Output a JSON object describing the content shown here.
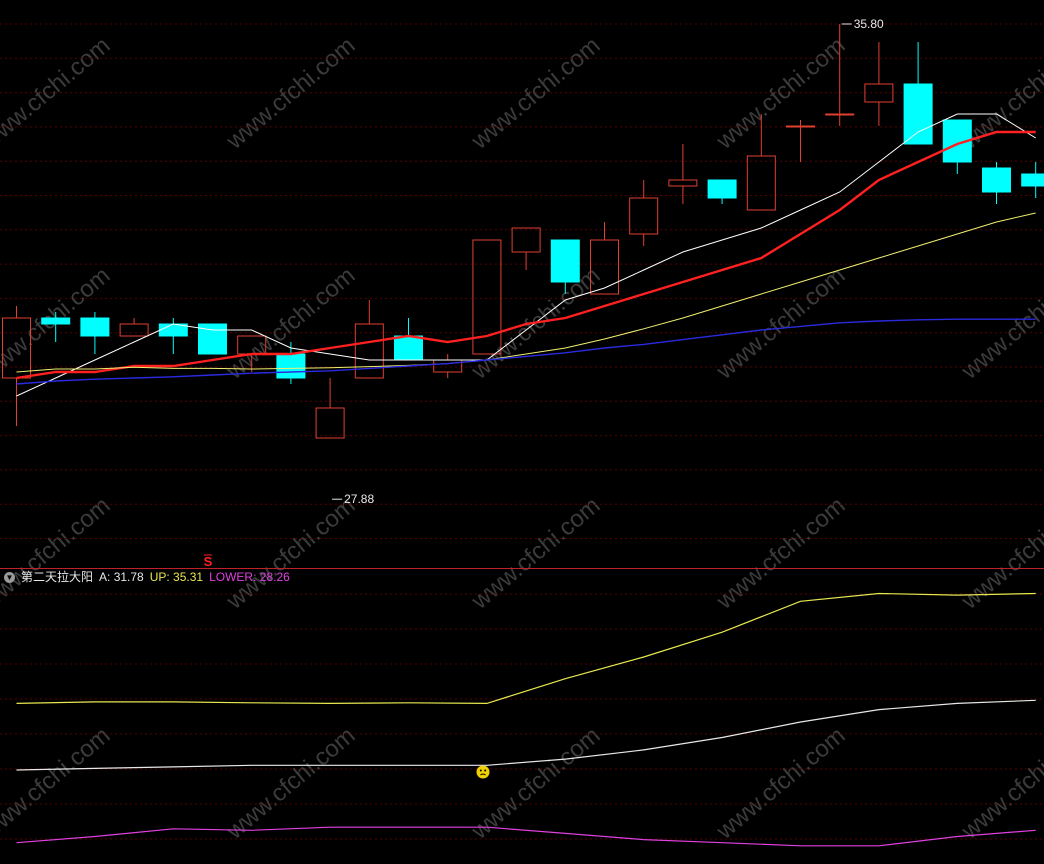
{
  "chart_data": [
    {
      "type": "candlestick",
      "price_range": [
        27.0,
        36.2
      ],
      "candles": [
        {
          "o": 29.9,
          "h": 31.1,
          "l": 29.1,
          "c": 30.9
        },
        {
          "o": 30.9,
          "h": 31.0,
          "l": 30.5,
          "c": 30.8
        },
        {
          "o": 30.9,
          "h": 31.0,
          "l": 30.3,
          "c": 30.6
        },
        {
          "o": 30.6,
          "h": 30.9,
          "l": 30.6,
          "c": 30.8
        },
        {
          "o": 30.8,
          "h": 30.9,
          "l": 30.3,
          "c": 30.6
        },
        {
          "o": 30.8,
          "h": 30.8,
          "l": 30.3,
          "c": 30.3
        },
        {
          "o": 30.3,
          "h": 30.6,
          "l": 30.0,
          "c": 30.6
        },
        {
          "o": 30.3,
          "h": 30.5,
          "l": 29.8,
          "c": 29.9
        },
        {
          "o": 28.9,
          "h": 29.9,
          "l": 28.9,
          "c": 29.4
        },
        {
          "o": 29.9,
          "h": 31.2,
          "l": 29.9,
          "c": 30.8
        },
        {
          "o": 30.6,
          "h": 30.9,
          "l": 30.2,
          "c": 30.2
        },
        {
          "o": 30.0,
          "h": 30.3,
          "l": 29.9,
          "c": 30.2
        },
        {
          "o": 30.3,
          "h": 32.2,
          "l": 30.3,
          "c": 32.2
        },
        {
          "o": 32.0,
          "h": 32.4,
          "l": 31.7,
          "c": 32.4
        },
        {
          "o": 32.2,
          "h": 32.2,
          "l": 31.3,
          "c": 31.5
        },
        {
          "o": 31.3,
          "h": 32.5,
          "l": 31.3,
          "c": 32.2
        },
        {
          "o": 32.3,
          "h": 33.2,
          "l": 32.1,
          "c": 32.9
        },
        {
          "o": 33.1,
          "h": 33.8,
          "l": 32.8,
          "c": 33.2
        },
        {
          "o": 33.2,
          "h": 33.2,
          "l": 32.8,
          "c": 32.9
        },
        {
          "o": 32.7,
          "h": 34.3,
          "l": 32.7,
          "c": 33.6
        },
        {
          "o": 34.1,
          "h": 34.2,
          "l": 33.5,
          "c": 34.1
        },
        {
          "o": 34.3,
          "h": 35.8,
          "l": 34.1,
          "c": 34.3
        },
        {
          "o": 34.5,
          "h": 35.5,
          "l": 34.1,
          "c": 34.8
        },
        {
          "o": 34.8,
          "h": 35.5,
          "l": 33.8,
          "c": 33.8
        },
        {
          "o": 34.2,
          "h": 34.2,
          "l": 33.3,
          "c": 33.5
        },
        {
          "o": 33.4,
          "h": 33.5,
          "l": 32.8,
          "c": 33.0
        },
        {
          "o": 33.3,
          "h": 33.5,
          "l": 32.9,
          "c": 33.1
        }
      ],
      "ma": [
        {
          "name": "MA5",
          "color": "#ffffff",
          "width": 1,
          "values": [
            29.6,
            29.9,
            30.2,
            30.5,
            30.8,
            30.7,
            30.7,
            30.4,
            30.3,
            30.2,
            30.2,
            30.2,
            30.2,
            30.7,
            31.2,
            31.4,
            31.7,
            32.0,
            32.2,
            32.4,
            32.7,
            33.0,
            33.5,
            34.0,
            34.3,
            34.3,
            33.9
          ]
        },
        {
          "name": "MA10",
          "color": "#ff2020",
          "width": 2.4,
          "values": [
            29.9,
            30.0,
            30.0,
            30.1,
            30.1,
            30.2,
            30.3,
            30.3,
            30.4,
            30.5,
            30.6,
            30.5,
            30.6,
            30.8,
            30.9,
            31.1,
            31.3,
            31.5,
            31.7,
            31.9,
            32.3,
            32.7,
            33.2,
            33.5,
            33.8,
            34.0,
            34.0
          ]
        },
        {
          "name": "MA20",
          "color": "#f0f070",
          "width": 1,
          "values": [
            30.0,
            30.05,
            30.05,
            30.08,
            30.06,
            30.06,
            30.05,
            30.06,
            30.07,
            30.09,
            30.11,
            30.14,
            30.2,
            30.3,
            30.4,
            30.55,
            30.72,
            30.9,
            31.1,
            31.3,
            31.5,
            31.7,
            31.9,
            32.1,
            32.3,
            32.5,
            32.65
          ]
        },
        {
          "name": "MA60",
          "color": "#2a2adf",
          "width": 1.4,
          "values": [
            29.8,
            29.85,
            29.88,
            29.9,
            29.92,
            29.95,
            29.98,
            30.0,
            30.02,
            30.06,
            30.1,
            30.14,
            30.2,
            30.26,
            30.32,
            30.4,
            30.46,
            30.54,
            30.62,
            30.7,
            30.76,
            30.82,
            30.85,
            30.87,
            30.88,
            30.88,
            30.88
          ]
        }
      ],
      "annotations": [
        {
          "label": "35.80",
          "candle": 21,
          "price": 35.8
        },
        {
          "label": "27.88",
          "candle": 8,
          "price": 27.88
        }
      ]
    },
    {
      "type": "line",
      "indicator": "第二天拉大阳",
      "y_range": [
        27.8,
        36.2
      ],
      "x": [
        0,
        2,
        4,
        6,
        8,
        10,
        12,
        14,
        16,
        18,
        20,
        22,
        24,
        26
      ],
      "series": [
        {
          "name": "UP",
          "color": "#e8e850",
          "values": [
            32.6,
            32.65,
            32.65,
            32.62,
            32.6,
            32.62,
            32.6,
            33.4,
            34.1,
            34.9,
            35.9,
            36.15,
            36.1,
            36.15
          ]
        },
        {
          "name": "A",
          "color": "#e8e8e8",
          "values": [
            30.45,
            30.5,
            30.55,
            30.6,
            30.6,
            30.6,
            30.6,
            30.8,
            31.1,
            31.5,
            32.0,
            32.4,
            32.6,
            32.7
          ]
        },
        {
          "name": "LOWER",
          "color": "#e040e0",
          "values": [
            28.1,
            28.3,
            28.55,
            28.5,
            28.6,
            28.6,
            28.6,
            28.4,
            28.2,
            28.1,
            28.0,
            28.0,
            28.3,
            28.5
          ]
        }
      ]
    }
  ],
  "indicator": {
    "name": "第二天拉大阳",
    "a_text": "A: 31.78",
    "up_text": "UP: 35.31",
    "lower_text": "LOWER: 28.26"
  },
  "marker_text": "S",
  "watermark_text": "www.cfchi.com",
  "colors": {
    "up_candle": "#e04030",
    "down_candle": "#00ffff",
    "grid": "#5a0000",
    "separator": "#c0202a",
    "annotation": "#e8e8e8",
    "marker": "#ff2020",
    "smiley": "#f0d000",
    "watermark": "#3b3b3b"
  }
}
